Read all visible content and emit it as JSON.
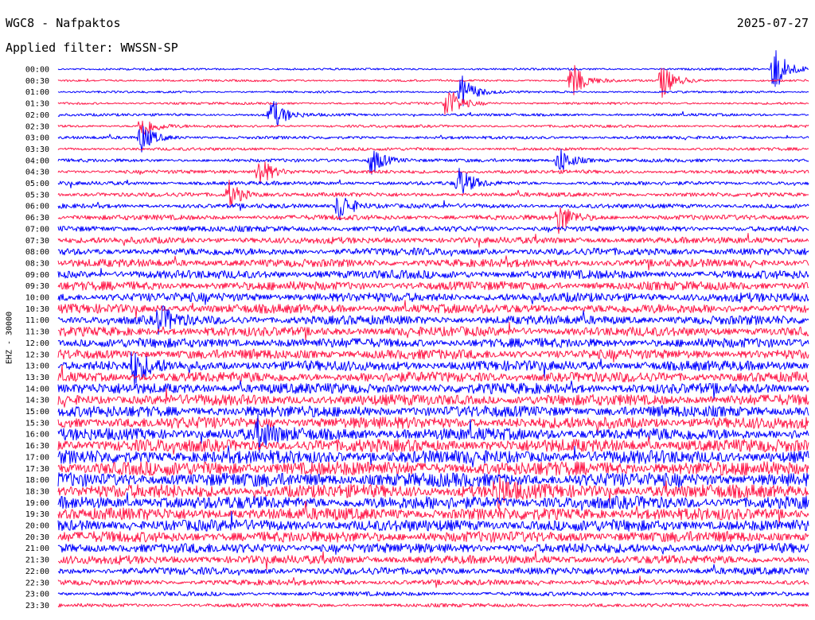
{
  "header": {
    "station": "WGC8 - Nafpaktos",
    "date": "2025-07-27",
    "filter_text": "Applied filter: WWSSN-SP"
  },
  "axis": {
    "channel_label": "EHZ - 30000"
  },
  "colors": {
    "trace_a": "#0000ff",
    "trace_b": "#ff1a4a",
    "background": "#ffffff",
    "text": "#000000"
  },
  "chart_data": {
    "type": "line",
    "title": "WGC8 - Nafpaktos",
    "subtitle": "Applied filter: WWSSN-SP",
    "ylabel": "EHZ - 30000",
    "xlabel": "",
    "grid": false,
    "legend": "none",
    "y_tick_labels": [
      "00:00",
      "00:30",
      "01:00",
      "01:30",
      "02:00",
      "02:30",
      "03:00",
      "03:30",
      "04:00",
      "04:30",
      "05:00",
      "05:30",
      "06:00",
      "06:30",
      "07:00",
      "07:30",
      "08:00",
      "08:30",
      "09:00",
      "09:30",
      "10:00",
      "10:30",
      "11:00",
      "11:30",
      "12:00",
      "12:30",
      "13:00",
      "13:30",
      "14:00",
      "14:30",
      "15:00",
      "15:30",
      "16:00",
      "16:30",
      "17:00",
      "17:30",
      "18:00",
      "18:30",
      "19:00",
      "19:30",
      "20:00",
      "20:30",
      "21:00",
      "21:30",
      "22:00",
      "22:30",
      "23:00",
      "23:30"
    ],
    "trace_color_cycle": [
      "#0000ff",
      "#ff1a4a"
    ],
    "noise_level_by_row": [
      0.35,
      0.35,
      0.35,
      0.4,
      0.45,
      0.45,
      0.5,
      0.5,
      0.55,
      0.6,
      0.65,
      0.7,
      0.75,
      0.85,
      0.95,
      1.05,
      1.2,
      1.3,
      1.4,
      1.45,
      1.5,
      1.5,
      1.5,
      1.55,
      1.55,
      1.6,
      1.65,
      1.7,
      1.75,
      1.8,
      1.85,
      1.9,
      2.0,
      2.1,
      2.2,
      2.3,
      2.3,
      2.2,
      2.1,
      2.0,
      1.9,
      1.8,
      1.6,
      1.4,
      1.2,
      0.9,
      0.7,
      0.6
    ],
    "events": [
      {
        "row": 0,
        "minute": 28.6,
        "amplitude": 3.5
      },
      {
        "row": 1,
        "minute": 20.5,
        "amplitude": 2.6
      },
      {
        "row": 1,
        "minute": 24.1,
        "amplitude": 2.4
      },
      {
        "row": 2,
        "minute": 16.1,
        "amplitude": 2.3
      },
      {
        "row": 3,
        "minute": 15.5,
        "amplitude": 2.6
      },
      {
        "row": 4,
        "minute": 8.5,
        "amplitude": 2.4
      },
      {
        "row": 5,
        "minute": 3.3,
        "amplitude": 1.9
      },
      {
        "row": 6,
        "minute": 3.3,
        "amplitude": 2.0
      },
      {
        "row": 8,
        "minute": 12.5,
        "amplitude": 2.1
      },
      {
        "row": 8,
        "minute": 20.0,
        "amplitude": 2.1
      },
      {
        "row": 9,
        "minute": 8.0,
        "amplitude": 2.3
      },
      {
        "row": 10,
        "minute": 16.0,
        "amplitude": 2.2
      },
      {
        "row": 11,
        "minute": 6.8,
        "amplitude": 2.0
      },
      {
        "row": 12,
        "minute": 11.2,
        "amplitude": 2.3
      },
      {
        "row": 13,
        "minute": 20.0,
        "amplitude": 2.1
      },
      {
        "row": 22,
        "minute": 4.0,
        "amplitude": 2.0
      },
      {
        "row": 26,
        "minute": 3.0,
        "amplitude": 2.5
      },
      {
        "row": 32,
        "minute": 8.0,
        "amplitude": 2.0
      },
      {
        "row": 37,
        "minute": 17.5,
        "amplitude": 2.2
      }
    ]
  }
}
